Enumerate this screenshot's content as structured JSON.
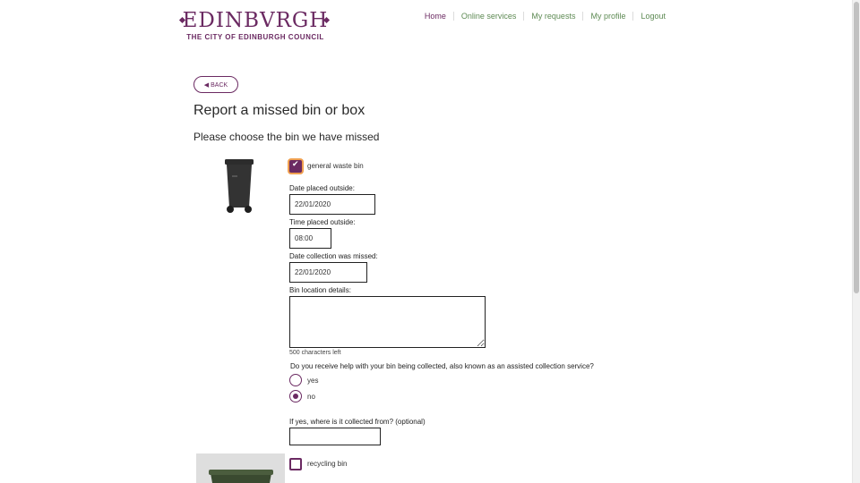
{
  "header": {
    "logo_wordmark": "EDINBVRGH",
    "logo_subtitle": "THE CITY OF EDINBURGH COUNCIL",
    "nav": [
      "Home",
      "Online services",
      "My requests",
      "My profile",
      "Logout"
    ]
  },
  "back_label": "◀ BACK",
  "page_title": "Report a missed bin or box",
  "section_title": "Please choose the bin we have missed",
  "bins": [
    {
      "label": "general waste bin",
      "checked": true,
      "fields": {
        "date_placed_label": "Date placed outside:",
        "date_placed_value": "22/01/2020",
        "time_placed_label": "Time placed outside:",
        "time_placed_value": "08:00",
        "date_missed_label": "Date collection was missed:",
        "date_missed_value": "22/01/2020",
        "location_label": "Bin location details:",
        "location_value": "",
        "chars_left": "500 characters left",
        "assisted_question": "Do you receive help with your bin being collected, also known as an assisted collection service?",
        "radio_yes": "yes",
        "radio_no": "no",
        "assisted_selected": "no",
        "collected_from_label": "If yes, where is it collected from? (optional)",
        "collected_from_value": ""
      }
    },
    {
      "label": "recycling bin",
      "checked": false
    }
  ],
  "colors": {
    "brand_purple": "#6b2a62",
    "nav_green": "#5d8a53"
  }
}
